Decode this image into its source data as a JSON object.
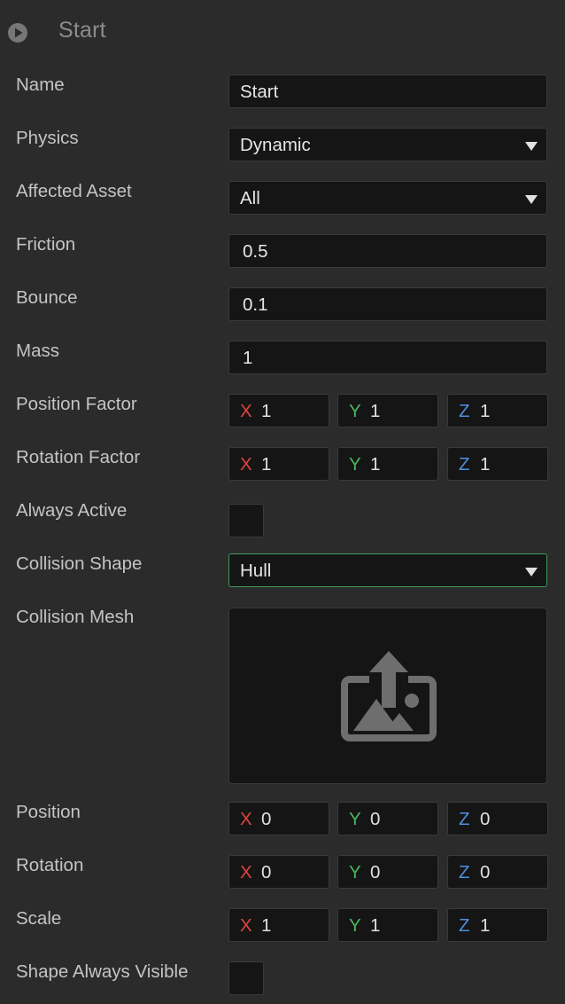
{
  "header": {
    "title": "Start",
    "icon": "play-icon"
  },
  "fields": {
    "name": {
      "label": "Name",
      "value": "Start"
    },
    "physics": {
      "label": "Physics",
      "value": "Dynamic"
    },
    "affected_asset": {
      "label": "Affected Asset",
      "value": "All"
    },
    "friction": {
      "label": "Friction",
      "value": "0.5"
    },
    "bounce": {
      "label": "Bounce",
      "value": "0.1"
    },
    "mass": {
      "label": "Mass",
      "value": "1"
    },
    "position_factor": {
      "label": "Position Factor",
      "x": "1",
      "y": "1",
      "z": "1"
    },
    "rotation_factor": {
      "label": "Rotation Factor",
      "x": "1",
      "y": "1",
      "z": "1"
    },
    "always_active": {
      "label": "Always Active",
      "checked": false
    },
    "collision_shape": {
      "label": "Collision Shape",
      "value": "Hull"
    },
    "collision_mesh": {
      "label": "Collision Mesh",
      "icon": "image-upload-icon"
    },
    "position": {
      "label": "Position",
      "x": "0",
      "y": "0",
      "z": "0"
    },
    "rotation": {
      "label": "Rotation",
      "x": "0",
      "y": "0",
      "z": "0"
    },
    "scale": {
      "label": "Scale",
      "x": "1",
      "y": "1",
      "z": "1"
    },
    "shape_always_visible": {
      "label": "Shape Always Visible",
      "checked": false
    }
  },
  "axes": {
    "x": "X",
    "y": "Y",
    "z": "Z"
  },
  "colors": {
    "background": "#2b2b2b",
    "field_bg": "#151515",
    "axis_x": "#e0433d",
    "axis_y": "#46b75c",
    "axis_z": "#4f8fe0",
    "focus_border": "#3f9a5a"
  }
}
